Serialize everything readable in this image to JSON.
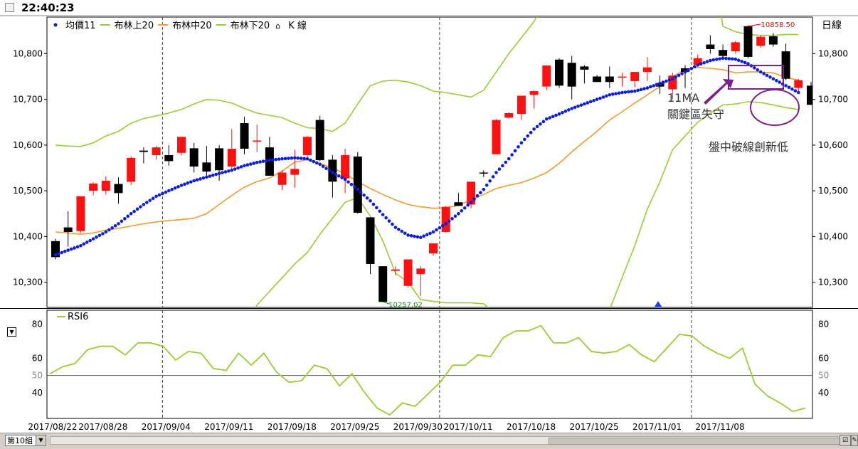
{
  "window": {
    "time": "22:40:23",
    "group_select": "第10組"
  },
  "legend": {
    "items": [
      {
        "label": "均價11",
        "color": "#0a1edc",
        "style": "dot"
      },
      {
        "label": "布林上20",
        "color": "#9acd32",
        "style": "line"
      },
      {
        "label": "布林中20",
        "color": "#f39a2c",
        "style": "line"
      },
      {
        "label": "布林下20",
        "color": "#9acd32",
        "style": "line"
      },
      {
        "label": "K 線",
        "color": "#000000",
        "style": "candle"
      }
    ],
    "right_label": "日線"
  },
  "annotations": {
    "max_label": "10858.50",
    "min_label": "10257.02",
    "ma_text": "11MA",
    "ma_text2": "關鍵區失守",
    "break_text": "盤中破線創新低"
  },
  "colors": {
    "up": "#ff1010",
    "down": "#000000",
    "upper": "#9acd32",
    "mid": "#f39a2c",
    "ma": "#0a1edc",
    "rsi": "#9acd32",
    "annot": "#7a1f8c",
    "grid": "#444444"
  },
  "chart_data": {
    "type": "candlestick",
    "price_ticks": [
      "10,800",
      "10,700",
      "10,600",
      "10,500",
      "10,400",
      "10,300"
    ],
    "price_tick_values": [
      10800,
      10700,
      10600,
      10500,
      10400,
      10300
    ],
    "ylim": [
      10245,
      10880
    ],
    "x_ticks": [
      {
        "index": 0,
        "label": "2017/08/22"
      },
      {
        "index": 4,
        "label": "2017/08/28"
      },
      {
        "index": 9,
        "label": "2017/09/04"
      },
      {
        "index": 14,
        "label": "2017/09/11"
      },
      {
        "index": 19,
        "label": "2017/09/18"
      },
      {
        "index": 24,
        "label": "2017/09/25"
      },
      {
        "index": 29,
        "label": "2017/09/30"
      },
      {
        "index": 33,
        "label": "2017/10/11"
      },
      {
        "index": 38,
        "label": "2017/10/18"
      },
      {
        "index": 43,
        "label": "2017/10/25"
      },
      {
        "index": 48,
        "label": "2017/11/01"
      },
      {
        "index": 53,
        "label": "2017/11/08"
      }
    ],
    "month_separators": [
      8.5,
      30.5,
      50.5
    ],
    "candles": [
      [
        10390,
        10395,
        10350,
        10355
      ],
      [
        10420,
        10455,
        10378,
        10410
      ],
      [
        10412,
        10488,
        10408,
        10488
      ],
      [
        10500,
        10518,
        10490,
        10516
      ],
      [
        10500,
        10532,
        10492,
        10522
      ],
      [
        10515,
        10530,
        10472,
        10495
      ],
      [
        10520,
        10575,
        10513,
        10572
      ],
      [
        10588,
        10595,
        10560,
        10585
      ],
      [
        10578,
        10598,
        10568,
        10595
      ],
      [
        10578,
        10600,
        10555,
        10565
      ],
      [
        10583,
        10618,
        10577,
        10618
      ],
      [
        10593,
        10605,
        10540,
        10553
      ],
      [
        10562,
        10598,
        10530,
        10542
      ],
      [
        10593,
        10600,
        10522,
        10545
      ],
      [
        10553,
        10635,
        10542,
        10592
      ],
      [
        10648,
        10662,
        10580,
        10592
      ],
      [
        10608,
        10645,
        10585,
        10610
      ],
      [
        10595,
        10618,
        10535,
        10533
      ],
      [
        10513,
        10545,
        10502,
        10540
      ],
      [
        10535,
        10590,
        10507,
        10548
      ],
      [
        10578,
        10620,
        10573,
        10618
      ],
      [
        10655,
        10664,
        10565,
        10567
      ],
      [
        10568,
        10578,
        10485,
        10520
      ],
      [
        10527,
        10592,
        10495,
        10578
      ],
      [
        10575,
        10585,
        10450,
        10452
      ],
      [
        10442,
        10442,
        10318,
        10340
      ],
      [
        10335,
        10335,
        10258,
        10257
      ],
      [
        10325,
        10335,
        10315,
        10328
      ],
      [
        10292,
        10350,
        10288,
        10350
      ],
      [
        10318,
        10335,
        10270,
        10330
      ],
      [
        10363,
        10385,
        10358,
        10385
      ],
      [
        10410,
        10467,
        10408,
        10465
      ],
      [
        10475,
        10495,
        10467,
        10467
      ],
      [
        10470,
        10520,
        10462,
        10520
      ],
      [
        10540,
        10545,
        10530,
        10538
      ],
      [
        10580,
        10657,
        10580,
        10655
      ],
      [
        10660,
        10672,
        10658,
        10670
      ],
      [
        10668,
        10708,
        10655,
        10708
      ],
      [
        10710,
        10720,
        10680,
        10718
      ],
      [
        10728,
        10774,
        10720,
        10774
      ],
      [
        10787,
        10790,
        10725,
        10730
      ],
      [
        10780,
        10795,
        10700,
        10728
      ],
      [
        10772,
        10775,
        10735,
        10765
      ],
      [
        10750,
        10753,
        10740,
        10738
      ],
      [
        10750,
        10772,
        10725,
        10738
      ],
      [
        10748,
        10758,
        10728,
        10750
      ],
      [
        10740,
        10760,
        10727,
        10760
      ],
      [
        10760,
        10793,
        10740,
        10770
      ],
      [
        10736,
        10752,
        10712,
        10728
      ],
      [
        10722,
        10758,
        10700,
        10752
      ],
      [
        10768,
        10775,
        10725,
        10760
      ],
      [
        10775,
        10798,
        10775,
        10790
      ],
      [
        10820,
        10840,
        10800,
        10810
      ],
      [
        10808,
        10820,
        10787,
        10795
      ],
      [
        10805,
        10828,
        10800,
        10825
      ],
      [
        10860,
        10862,
        10790,
        10793
      ],
      [
        10817,
        10840,
        10813,
        10837
      ],
      [
        10838,
        10845,
        10815,
        10820
      ],
      [
        10805,
        10822,
        10742,
        10745
      ],
      [
        10725,
        10745,
        10718,
        10742
      ],
      [
        10730,
        10738,
        10690,
        10688
      ],
      [
        10715,
        10728,
        10683,
        10690
      ]
    ],
    "series": [
      {
        "name": "均價11",
        "values": [
          10360,
          10370,
          10380,
          10395,
          10410,
          10428,
          10450,
          10470,
          10488,
          10500,
          10512,
          10522,
          10530,
          10538,
          10545,
          10555,
          10562,
          10567,
          10570,
          10572,
          10570,
          10558,
          10540,
          10525,
          10503,
          10478,
          10448,
          10420,
          10403,
          10398,
          10410,
          10428,
          10450,
          10475,
          10503,
          10540,
          10570,
          10605,
          10635,
          10657,
          10668,
          10680,
          10690,
          10700,
          10710,
          10715,
          10718,
          10725,
          10735,
          10745,
          10760,
          10775,
          10785,
          10790,
          10788,
          10778,
          10760,
          10745,
          10730,
          10715
        ]
      },
      {
        "name": "布林上20",
        "values": [
          10600,
          10598,
          10597,
          10605,
          10620,
          10630,
          10648,
          10658,
          10664,
          10670,
          10678,
          10690,
          10700,
          10698,
          10692,
          10680,
          10670,
          10665,
          10660,
          10648,
          10638,
          10636,
          10630,
          10648,
          10690,
          10730,
          10740,
          10742,
          10738,
          10730,
          10718,
          10715,
          10710,
          10705,
          10720,
          10760,
          10800,
          10835,
          10870,
          10920,
          10960,
          10990,
          11010,
          11030,
          11050,
          11070,
          11080,
          11090,
          11095,
          11098,
          11092,
          11070,
          11040,
          10860,
          10848,
          10842,
          10840,
          10840,
          10842,
          10842
        ]
      },
      {
        "name": "布林中20",
        "values": [
          10410,
          10408,
          10405,
          10408,
          10414,
          10418,
          10423,
          10428,
          10432,
          10435,
          10437,
          10440,
          10450,
          10470,
          10490,
          10508,
          10520,
          10528,
          10543,
          10563,
          10568,
          10560,
          10550,
          10537,
          10520,
          10505,
          10492,
          10480,
          10470,
          10465,
          10462,
          10463,
          10468,
          10480,
          10492,
          10505,
          10512,
          10518,
          10528,
          10540,
          10560,
          10585,
          10608,
          10630,
          10655,
          10673,
          10692,
          10710,
          10728,
          10750,
          10765,
          10770,
          10768,
          10765,
          10758,
          10760,
          10760,
          10758,
          10748,
          10742
        ]
      },
      {
        "name": "布林下20",
        "values": [
          10200,
          10205,
          10210,
          10210,
          10205,
          10200,
          10195,
          10192,
          10190,
          10186,
          10182,
          10178,
          10170,
          10168,
          10175,
          10200,
          10250,
          10280,
          10310,
          10340,
          10365,
          10405,
          10440,
          10475,
          10485,
          10445,
          10390,
          10320,
          10300,
          10262,
          10258,
          10255,
          10255,
          10255,
          10253,
          10230,
          10210,
          10200,
          10180,
          10160,
          10155,
          10150,
          10150,
          10200,
          10240,
          10310,
          10380,
          10460,
          10520,
          10590,
          10620,
          10650,
          10670,
          10688,
          10690,
          10695,
          10693,
          10688,
          10682,
          10678
        ]
      }
    ],
    "rsi": {
      "name": "RSI6",
      "ticks": [
        80,
        60,
        50,
        40
      ],
      "ref": 50,
      "ylim": [
        25,
        88
      ],
      "values": [
        51,
        55,
        57,
        65,
        67,
        67,
        62,
        69,
        69,
        67,
        59,
        64,
        63,
        54,
        53,
        63,
        56,
        63,
        52,
        46,
        47,
        56,
        54,
        44,
        51,
        40,
        31,
        27,
        34,
        32,
        39,
        46,
        56,
        56,
        62,
        61,
        72,
        76,
        76,
        79,
        69,
        69,
        72,
        64,
        63,
        64,
        68,
        62,
        58,
        66,
        74,
        73,
        67,
        63,
        60,
        66,
        45,
        38,
        34,
        29,
        31
      ]
    }
  }
}
